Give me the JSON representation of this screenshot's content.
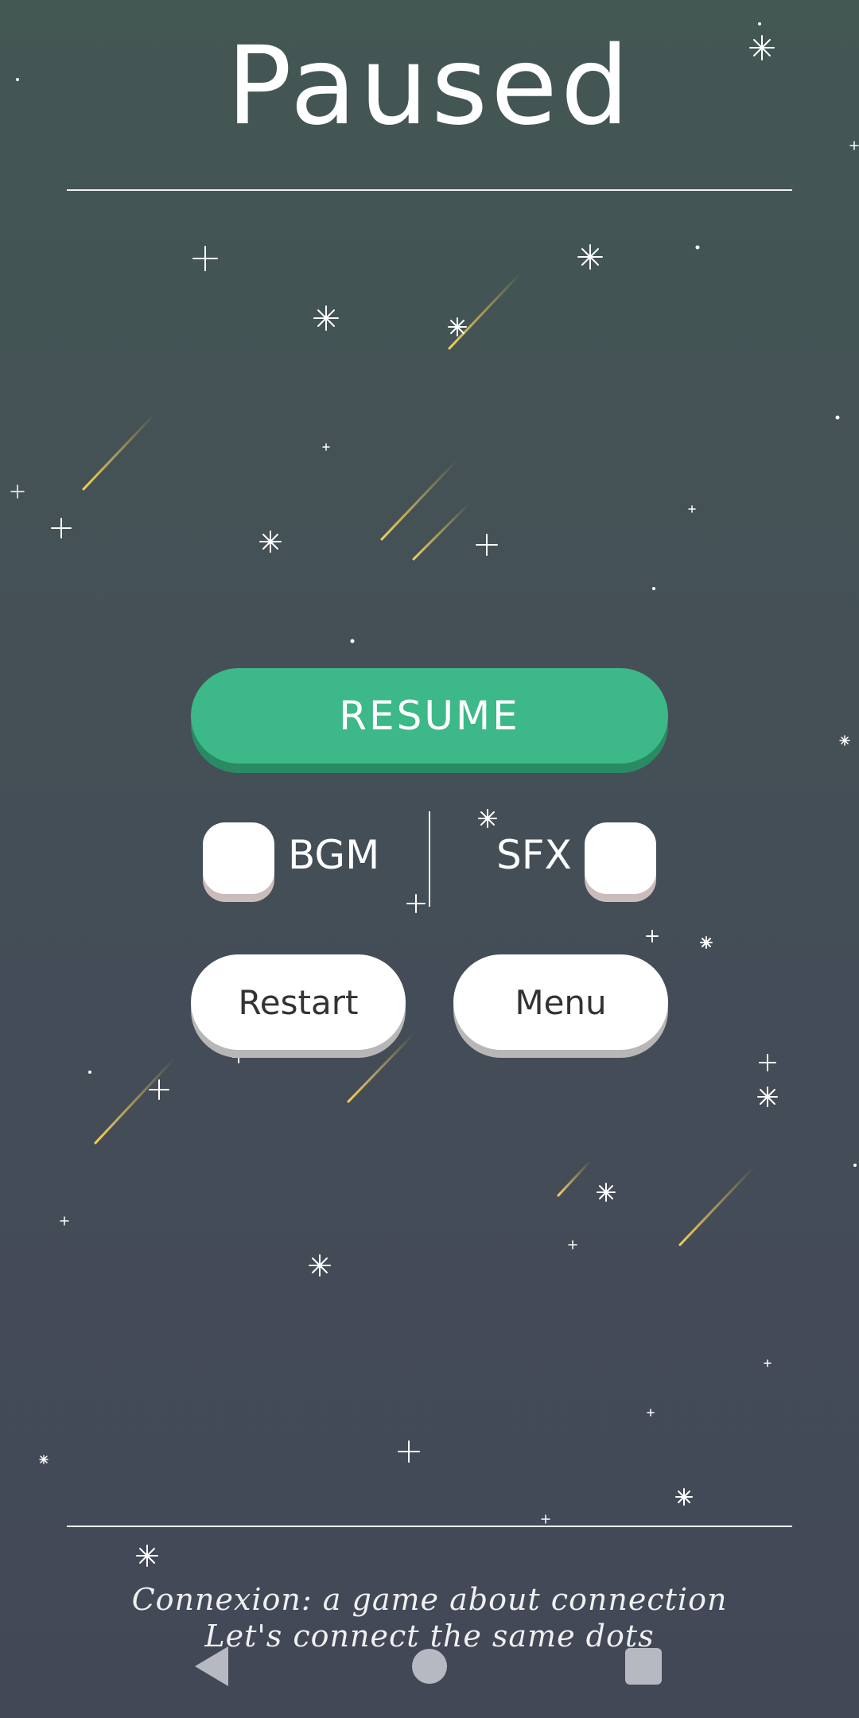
{
  "screen": {
    "title": "Paused",
    "resume_label": "RESUME",
    "bgm_label": "BGM",
    "sfx_label": "SFX",
    "bgm_enabled": false,
    "sfx_enabled": false,
    "restart_label": "Restart",
    "menu_label": "Menu",
    "footer_line1": "Connexion: a game about connection",
    "footer_line2": "Let's connect the same dots"
  },
  "system_nav": {
    "back_icon": "back-triangle-icon",
    "home_icon": "home-circle-icon",
    "recents_icon": "recents-square-icon"
  },
  "colors": {
    "background_top": "#435753",
    "background_bottom": "#434857",
    "resume_button": "#3db889",
    "button_white": "#ffffff",
    "meteor": "#f2c94c",
    "star": "#ffffff"
  }
}
